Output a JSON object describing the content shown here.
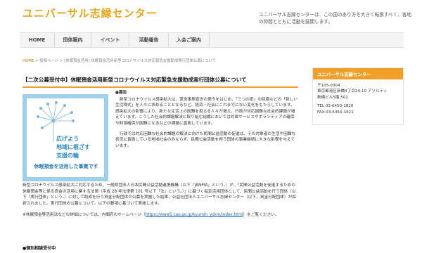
{
  "header": {
    "logo": "ユニバーサル志縁センター",
    "description": "ユニバーサル志縁センターは、この国のあり方を大きく転換すべく、各地の仲間とともに活動を展開します。"
  },
  "nav": {
    "items": [
      {
        "label": "HOME"
      },
      {
        "label": "団体案内"
      },
      {
        "label": "イベント"
      },
      {
        "label": "活動報告"
      },
      {
        "label": "入会ご案内"
      }
    ]
  },
  "breadcrumb": {
    "home": "HOME",
    "rest": " > 投稿ページ > [休眠預金活用] 休眠預金活用新型コロナウイルス対応緊急支援助成実行団体公募について"
  },
  "article": {
    "title": "【二次公募受付中】休眠預金活用新型コロナウイルス対応緊急支援助成実行団体公募について",
    "feature_image": {
      "headline_lines": [
        "広げよう",
        "地域に根ざす",
        "支援の輪"
      ],
      "caption": "休眠預金を活用した事業です"
    },
    "lead": "●趣旨",
    "paragraph1": "新型コロナウイルス感染拡大は、緊急事態宣言の発令をはじめ、「三つの密」の回避などの「新しい生活様式」を人々に求めることとなるなど、経済・社会にこれまでにない変化をもたらしています。感染拡大の影響により、新たな生活上の困難を抱える人々が増え、行政が対応困難な社会的課題が増えています。こうした社会的課題解決に取り組む組織においては対面サービスやボランティアの確保や財源確保が困難になるなどの課題に直面しています。",
    "paragraph2": "行政では対応困難な社会的課題の解決に向けた民間公益活動の促進は、その対象者の生活や困難な状況に直面している地域社会のみならず、民間公益活動を担う団体の事業継続に大きな影響を与えています。",
    "paragraph3": "新型コロナウイルス感染拡大に対応するため、一般財団法人日本民間公益活動連携機構（以下「JANPIA」という。）が、「民間公益活動を促進するための休眠預金等に係る資金の活用に関する法律（平成 28 年法律第 101 号以下「法」という。）」に基づく指定活用団体として、民間公益活動を行う団体（以下「実行団体」という。）に対して助成を行う資金分配団体の公募を実施した結果、公益社団法人ユニバーサル志縁センター（以下、資金分配団体）が採択されました。実行団体の公募について、以下の要項に基づいて実施します。",
    "note_prefix": "※休眠預金等活用法などの詳細については、内閣府のホームページ（",
    "note_link": "https://www5.cao.go.jp/kyumin_yokin/index.html",
    "note_suffix": "）をご覧ください。",
    "section_mark": "●個別相談受付中"
  },
  "sidebar": {
    "title": "ユニバーサル志縁センター",
    "address_lines": [
      "〒105-0004",
      "東京都港区新橋4丁目24-10 アソルティ",
      "新橋ビル5階 502",
      "",
      "TEL 03-6450-1820",
      "FAX.03-6450-1821"
    ]
  },
  "colors": {
    "accent": "#f0a028",
    "logo": "#e8a61e",
    "feature_bg": "#9ed0ec",
    "link": "#1c62b4"
  }
}
